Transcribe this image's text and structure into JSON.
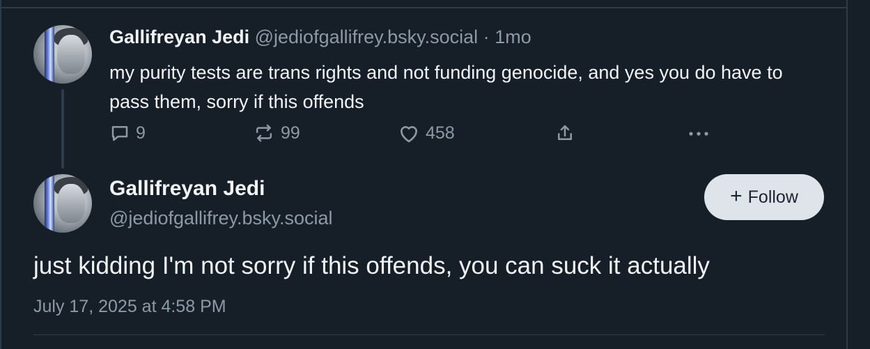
{
  "parent_post": {
    "author_name": "Gallifreyan Jedi",
    "handle": "@jediofgallifrey.bsky.social",
    "separator": "·",
    "age": "1mo",
    "text": "my purity tests are trans rights and not funding genocide, and yes you do have to pass them, sorry if this offends",
    "actions": {
      "reply_count": "9",
      "repost_count": "99",
      "like_count": "458"
    }
  },
  "main_post": {
    "author_name": "Gallifreyan Jedi",
    "handle": "@jediofgallifrey.bsky.social",
    "follow_label": "Follow",
    "text": "just kidding I'm not sorry if this offends, you can suck it actually",
    "timestamp": "July 17, 2025 at 4:58 PM"
  },
  "icons": {
    "reply": "reply-bubble-icon",
    "repost": "repost-arrows-icon",
    "like": "heart-icon",
    "share": "share-upload-icon",
    "more": "more-dots-icon",
    "plus": "plus-icon"
  },
  "colors": {
    "background": "#161e27",
    "text": "#f1f3f5",
    "muted": "#8c9aa8",
    "border": "#2e3b4a",
    "follow_button_bg": "#dfe4ea"
  }
}
